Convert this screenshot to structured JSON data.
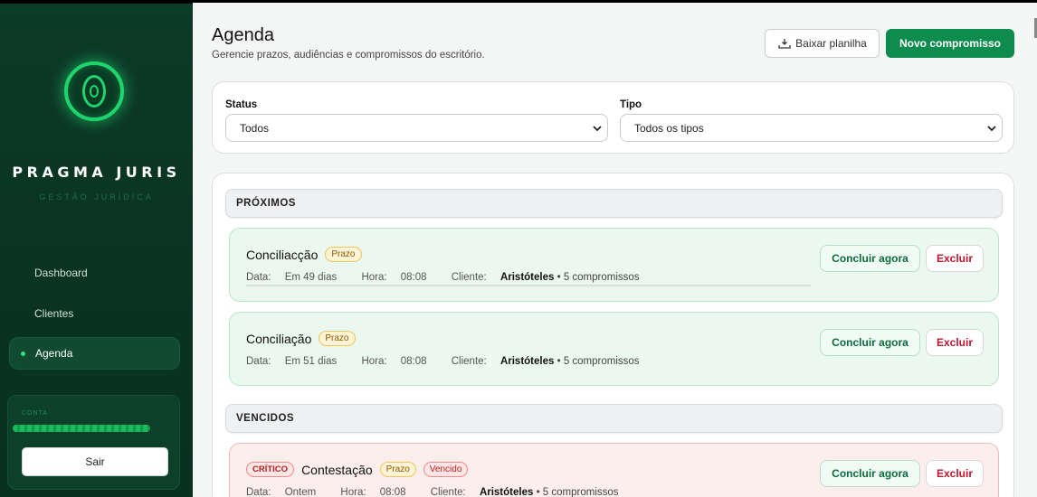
{
  "sidebar": {
    "brand": "PRAGMA JURIS",
    "brand_sub": "GESTÃO JURÍDICA",
    "items": [
      {
        "label": "Dashboard"
      },
      {
        "label": "Clientes"
      },
      {
        "label": "Agenda",
        "active": true
      }
    ],
    "account_label": "CONTA",
    "logout_label": "Sair"
  },
  "header": {
    "title": "Agenda",
    "subtitle": "Gerencie prazos, audiências e compromissos do escritório.",
    "download_label": "Baixar planilha",
    "new_label": "Novo compromisso"
  },
  "filters": {
    "status_label": "Status",
    "status_value": "Todos",
    "type_label": "Tipo",
    "type_value": "Todos os tipos"
  },
  "sections": {
    "upcoming": "PRÓXIMOS",
    "overdue": "VENCIDOS"
  },
  "cards": [
    {
      "title": "Conciliacção",
      "tag": "Prazo",
      "date_label": "Data:",
      "date": "Em 49 dias",
      "time_label": "Hora:",
      "time": "08:08",
      "client_label": "Cliente:",
      "client": "Aristóteles",
      "count": "• 5 compromissos",
      "done_label": "Concluir agora",
      "delete_label": "Excluir"
    },
    {
      "title": "Conciliação",
      "tag": "Prazo",
      "date_label": "Data:",
      "date": "Em 51 dias",
      "time_label": "Hora:",
      "time": "08:08",
      "client_label": "Cliente:",
      "client": "Aristóteles",
      "count": "• 5 compromissos",
      "done_label": "Concluir agora",
      "delete_label": "Excluir"
    },
    {
      "critical": "CRÍTICO",
      "title": "Contestação",
      "tag": "Prazo",
      "status_tag": "Vencido",
      "date_label": "Data:",
      "date": "Ontem",
      "time_label": "Hora:",
      "time": "08:08",
      "client_label": "Cliente:",
      "client": "Aristóteles",
      "count": "• 5 compromissos",
      "done_label": "Concluir agora",
      "delete_label": "Excluir"
    }
  ],
  "colors": {
    "sidebar_bg": "#0c3b28",
    "accent": "#0e8c4e",
    "danger": "#c0142e"
  }
}
